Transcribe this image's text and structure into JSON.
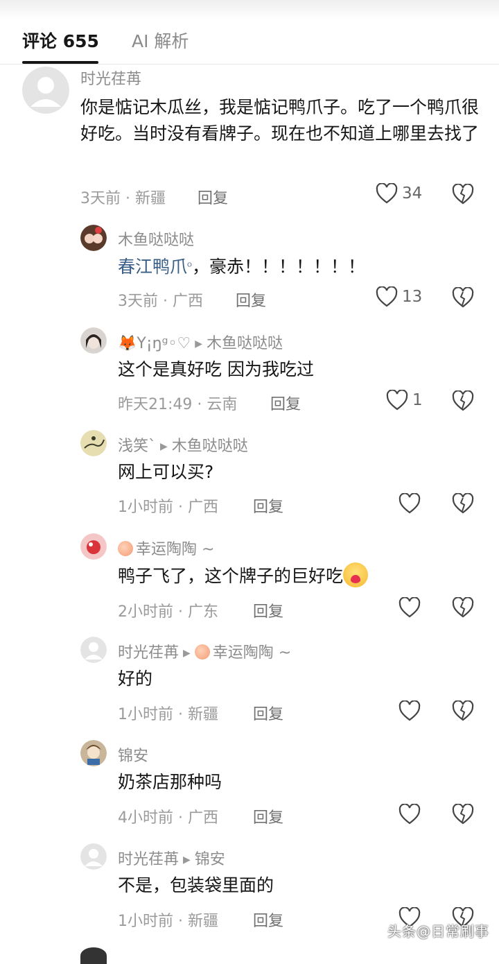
{
  "tabs": {
    "comments": "评论 655",
    "ai": "AI 解析"
  },
  "comments": [
    {
      "user": "时光荏苒",
      "text": "你是惦记木瓜丝，我是惦记鸭爪子。吃了一个鸭爪很好吃。当时没有看牌子。现在也不知道上哪里去找了",
      "time": "3天前 · 新疆",
      "reply": "回复",
      "likes": "34"
    },
    {
      "user": "木鱼哒哒哒",
      "link": "春江鸭爪",
      "search_mark": "ᴼ",
      "text": "，豪赤！！！！！！！",
      "time": "3天前 · 广西",
      "reply": "回复",
      "likes": "13"
    },
    {
      "user": "Y¡ŋᵍ◦♡",
      "reply_to": "木鱼哒哒哒",
      "text": "这个是真好吃 因为我吃过",
      "time": "昨天21:49 · 云南",
      "reply": "回复",
      "likes": "1"
    },
    {
      "user": "浅笑`",
      "reply_to": "木鱼哒哒哒",
      "text": "网上可以买?",
      "time": "1小时前 · 广西",
      "reply": "回复",
      "likes": ""
    },
    {
      "user": "幸运陶陶 ~",
      "text": "鸭子飞了，这个牌子的巨好吃",
      "time": "2小时前 · 广东",
      "reply": "回复",
      "likes": ""
    },
    {
      "user": "时光荏苒",
      "reply_to": "幸运陶陶 ~",
      "text": "好的",
      "time": "1小时前 · 新疆",
      "reply": "回复",
      "likes": ""
    },
    {
      "user": "锦安",
      "text": "奶茶店那种吗",
      "time": "4小时前 · 广西",
      "reply": "回复",
      "likes": ""
    },
    {
      "user": "时光荏苒",
      "reply_to": "锦安",
      "text": "不是，包装袋里面的",
      "time": "1小时前 · 新疆",
      "reply": "回复",
      "likes": ""
    }
  ],
  "watermark": "头条@日常刷事",
  "colors": {
    "link": "#3a5f86",
    "meta": "#9a9a9a",
    "text": "#161616"
  }
}
